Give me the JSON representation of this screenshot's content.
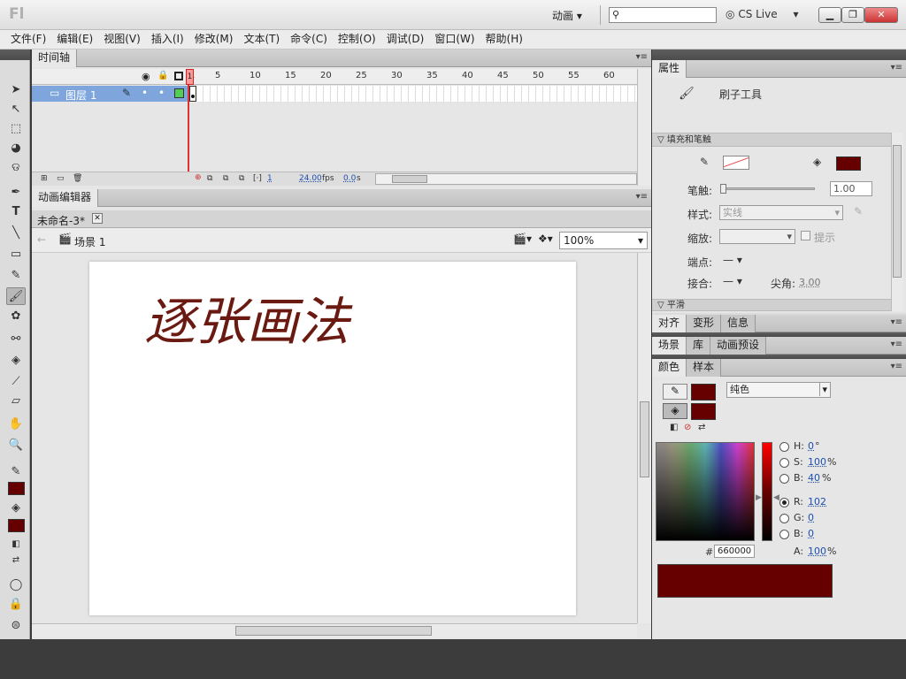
{
  "app": {
    "logo": "Fl",
    "workspace": "动画",
    "search_placeholder": "",
    "cs_live": "CS Live"
  },
  "menu": [
    "文件(F)",
    "编辑(E)",
    "视图(V)",
    "插入(I)",
    "修改(M)",
    "文本(T)",
    "命令(C)",
    "控制(O)",
    "调试(D)",
    "窗口(W)",
    "帮助(H)"
  ],
  "timeline": {
    "tab": "时间轴",
    "layer_name": "图层 1",
    "ruler": [
      "1",
      "5",
      "10",
      "15",
      "20",
      "25",
      "30",
      "35",
      "40",
      "45",
      "50",
      "55",
      "60"
    ],
    "footer": {
      "frame": "1",
      "fps": "24.00",
      "fps_unit": "fps",
      "time": "0.0",
      "time_unit": "s"
    }
  },
  "editor": {
    "tab": "动画编辑器",
    "doc_tab": "未命名-3*",
    "scene": "场景 1",
    "zoom": "100%",
    "canvas_text": "逐张画法"
  },
  "properties": {
    "tab": "属性",
    "tool": "刷子工具",
    "section_fill": "填充和笔触",
    "stroke_label": "笔触:",
    "stroke_value": "1.00",
    "style_label": "样式:",
    "style_value": "实线",
    "scale_label": "缩放:",
    "hint_label": "提示",
    "cap_label": "端点:",
    "join_label": "接合:",
    "miter_label": "尖角:",
    "miter_value": "3.00",
    "section_smooth": "平滑"
  },
  "panels_row1": [
    "对齐",
    "变形",
    "信息"
  ],
  "panels_row2": [
    "场景",
    "库",
    "动画预设"
  ],
  "color": {
    "tabs": [
      "颜色",
      "样本"
    ],
    "type": "纯色",
    "H_label": "H:",
    "H": "0",
    "H_unit": "°",
    "S_label": "S:",
    "S": "100",
    "S_unit": "%",
    "B_label": "B:",
    "B": "40",
    "B_unit": "%",
    "R_label": "R:",
    "R": "102",
    "G_label": "G:",
    "G": "0",
    "Bl_label": "B:",
    "Bl": "0",
    "hash": "#",
    "hex": "660000",
    "A_label": "A:",
    "A": "100",
    "A_unit": "%"
  },
  "colors": {
    "stroke": "#660000",
    "fill": "#660000",
    "layer_highlight": "#7ea6dd",
    "ink": "#6b1a12"
  }
}
